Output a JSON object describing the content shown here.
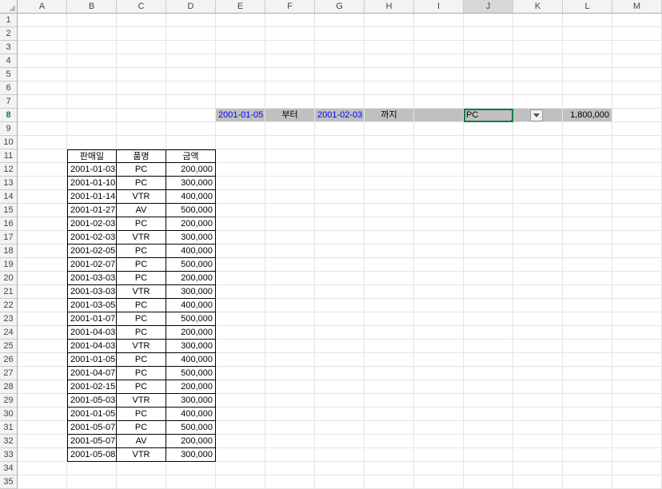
{
  "columns": [
    "A",
    "B",
    "C",
    "D",
    "E",
    "F",
    "G",
    "H",
    "I",
    "J",
    "K",
    "L",
    "M"
  ],
  "active_col_index": 9,
  "active_row": 8,
  "row_count": 35,
  "filter": {
    "date_from": "2001-01-05",
    "from_label": "부터",
    "date_to": "2001-02-03",
    "to_label": "까지",
    "item": "PC",
    "total": "1,800,000"
  },
  "table_headers": [
    "판매일",
    "품명",
    "금액"
  ],
  "table_rows": [
    {
      "date": "2001-01-03",
      "item": "PC",
      "amount": "200,000"
    },
    {
      "date": "2001-01-10",
      "item": "PC",
      "amount": "300,000"
    },
    {
      "date": "2001-01-14",
      "item": "VTR",
      "amount": "400,000"
    },
    {
      "date": "2001-01-27",
      "item": "AV",
      "amount": "500,000"
    },
    {
      "date": "2001-02-03",
      "item": "PC",
      "amount": "200,000"
    },
    {
      "date": "2001-02-03",
      "item": "VTR",
      "amount": "300,000"
    },
    {
      "date": "2001-02-05",
      "item": "PC",
      "amount": "400,000"
    },
    {
      "date": "2001-02-07",
      "item": "PC",
      "amount": "500,000"
    },
    {
      "date": "2001-03-03",
      "item": "PC",
      "amount": "200,000"
    },
    {
      "date": "2001-03-03",
      "item": "VTR",
      "amount": "300,000"
    },
    {
      "date": "2001-03-05",
      "item": "PC",
      "amount": "400,000"
    },
    {
      "date": "2001-01-07",
      "item": "PC",
      "amount": "500,000"
    },
    {
      "date": "2001-04-03",
      "item": "PC",
      "amount": "200,000"
    },
    {
      "date": "2001-04-03",
      "item": "VTR",
      "amount": "300,000"
    },
    {
      "date": "2001-01-05",
      "item": "PC",
      "amount": "400,000"
    },
    {
      "date": "2001-04-07",
      "item": "PC",
      "amount": "500,000"
    },
    {
      "date": "2001-02-15",
      "item": "PC",
      "amount": "200,000"
    },
    {
      "date": "2001-05-03",
      "item": "VTR",
      "amount": "300,000"
    },
    {
      "date": "2001-01-05",
      "item": "PC",
      "amount": "400,000"
    },
    {
      "date": "2001-05-07",
      "item": "PC",
      "amount": "500,000"
    },
    {
      "date": "2001-05-07",
      "item": "AV",
      "amount": "200,000"
    },
    {
      "date": "2001-05-08",
      "item": "VTR",
      "amount": "300,000"
    }
  ],
  "chart_data": {
    "type": "table",
    "title": "",
    "columns": [
      "판매일",
      "품명",
      "금액"
    ],
    "rows": [
      [
        "2001-01-03",
        "PC",
        200000
      ],
      [
        "2001-01-10",
        "PC",
        300000
      ],
      [
        "2001-01-14",
        "VTR",
        400000
      ],
      [
        "2001-01-27",
        "AV",
        500000
      ],
      [
        "2001-02-03",
        "PC",
        200000
      ],
      [
        "2001-02-03",
        "VTR",
        300000
      ],
      [
        "2001-02-05",
        "PC",
        400000
      ],
      [
        "2001-02-07",
        "PC",
        500000
      ],
      [
        "2001-03-03",
        "PC",
        200000
      ],
      [
        "2001-03-03",
        "VTR",
        300000
      ],
      [
        "2001-03-05",
        "PC",
        400000
      ],
      [
        "2001-01-07",
        "PC",
        500000
      ],
      [
        "2001-04-03",
        "PC",
        200000
      ],
      [
        "2001-04-03",
        "VTR",
        300000
      ],
      [
        "2001-01-05",
        "PC",
        400000
      ],
      [
        "2001-04-07",
        "PC",
        500000
      ],
      [
        "2001-02-15",
        "PC",
        200000
      ],
      [
        "2001-05-03",
        "VTR",
        300000
      ],
      [
        "2001-01-05",
        "PC",
        400000
      ],
      [
        "2001-05-07",
        "PC",
        500000
      ],
      [
        "2001-05-07",
        "AV",
        200000
      ],
      [
        "2001-05-08",
        "VTR",
        300000
      ]
    ]
  }
}
